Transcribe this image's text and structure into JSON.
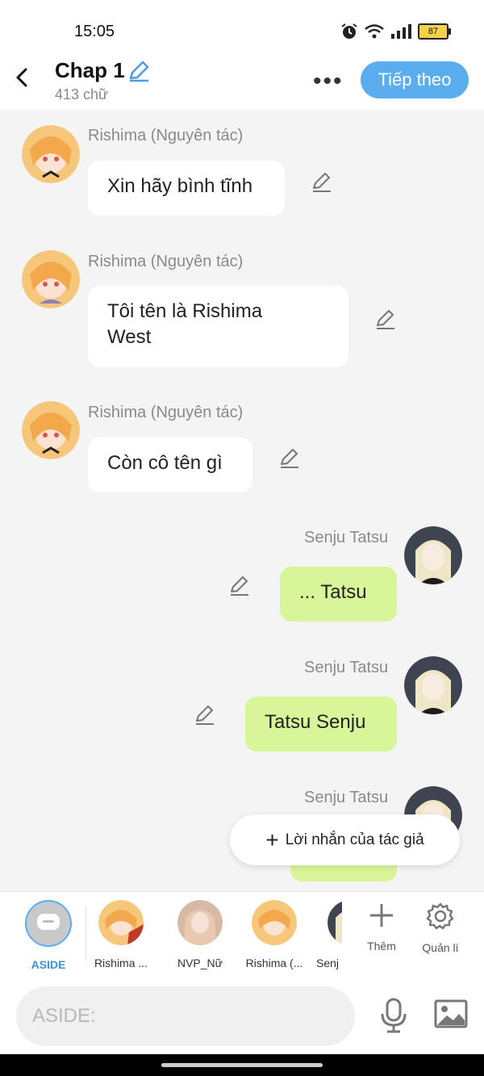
{
  "status": {
    "time": "15:05",
    "battery": "87"
  },
  "header": {
    "title": "Chap 1",
    "word_count": "413 chữ",
    "next_button": "Tiếp theo"
  },
  "messages": [
    {
      "sender": "Rishima (Nguyên tác)",
      "text": "Xin hãy bình tĩnh"
    },
    {
      "sender": "Rishima (Nguyên tác)",
      "text_line1": "Tôi tên là Rishima",
      "text_line2": "West"
    },
    {
      "sender": "Rishima (Nguyên tác)",
      "text": "Còn cô tên gì"
    },
    {
      "sender": "Senju Tatsu",
      "text": "... Tatsu"
    },
    {
      "sender": "Senju Tatsu",
      "text": "Tatsu Senju"
    },
    {
      "sender": "Senju Tatsu",
      "text": ""
    }
  ],
  "author_note_button": "Lời nhắn của tác giả",
  "characters": [
    {
      "label": "ASIDE"
    },
    {
      "label": "Rishima ..."
    },
    {
      "label": "NVP_Nữ"
    },
    {
      "label": "Rishima (..."
    },
    {
      "label": "Senj"
    }
  ],
  "tools": {
    "add_label": "Thêm",
    "manage_label": "Quản lí"
  },
  "input": {
    "placeholder": "ASIDE:"
  },
  "colors": {
    "accent": "#5aaef0",
    "user_bubble": "#d9f59a",
    "other_bubble": "#ffffff"
  },
  "icons": [
    "back-icon",
    "pencil-icon",
    "more-icon",
    "alarm-icon",
    "wifi-icon",
    "signal-icon",
    "battery-icon",
    "plus-icon",
    "gear-icon",
    "microphone-icon",
    "image-icon",
    "chat-bubble-icon"
  ]
}
